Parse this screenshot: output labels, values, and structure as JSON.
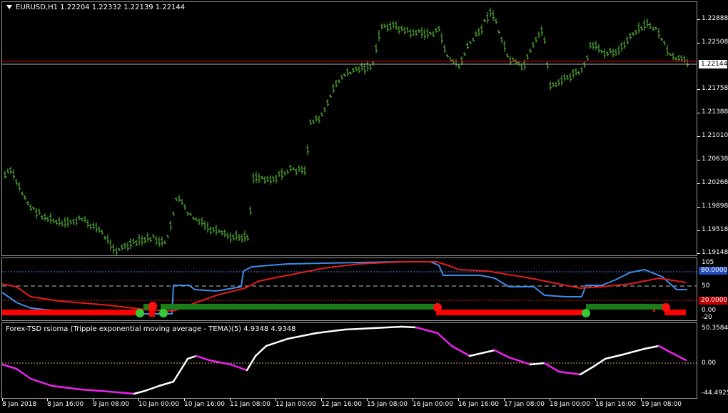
{
  "main_chart": {
    "title": "EURUSD,H1  1.22204  1.22332  1.22139  1.22144",
    "current_price": "1.22144",
    "price_labels": [
      "1.22888",
      "1.22508",
      "1.21758",
      "1.21388",
      "1.21010",
      "1.20638",
      "1.20268",
      "1.19898",
      "1.19518",
      "1.19148"
    ],
    "bar_color": "#5cc63a",
    "hline_color": "#e00000"
  },
  "indicator1": {
    "levels": [
      "105",
      "80.0000",
      "50",
      "20.0000",
      "0.00",
      "-20"
    ],
    "blue_line_color": "#3d8ce8",
    "red_line_color": "#e41b1b",
    "bull_color": "#1a7d1a",
    "bear_color": "#ff0000"
  },
  "indicator2": {
    "title": "Forex-TSD rsioma (Tripple exponential moving average - TEMA)(5) 4.9348 4.9348",
    "levels": [
      "50.3584",
      "0.00",
      "-44.4925"
    ],
    "up_color": "#ffffff",
    "down_color": "#ee22ee"
  },
  "time_axis": {
    "labels": [
      "8 Jan 2018",
      "8 Jan 16:00",
      "9 Jan 08:00",
      "10 Jan 00:00",
      "10 Jan 16:00",
      "11 Jan 08:00",
      "12 Jan 00:00",
      "12 Jan 16:00",
      "15 Jan 08:00",
      "16 Jan 00:00",
      "16 Jan 16:00",
      "17 Jan 08:00",
      "18 Jan 00:00",
      "18 Jan 16:00",
      "19 Jan 08:00"
    ]
  }
}
